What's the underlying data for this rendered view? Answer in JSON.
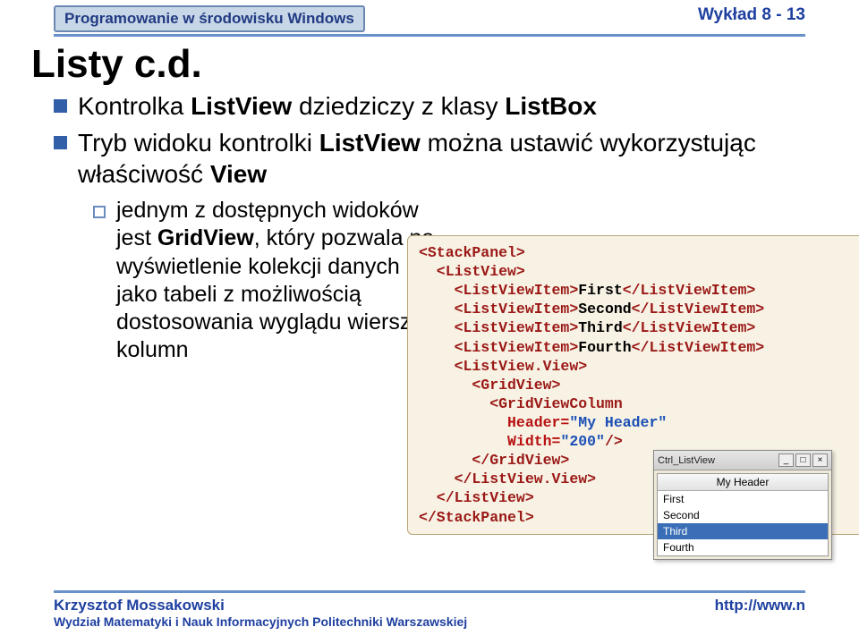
{
  "header": {
    "course": "Programowanie w środowisku Windows",
    "lecture": "Wykład 8 - 13"
  },
  "title": "Listy c.d.",
  "bullets": {
    "b1_pre": "Kontrolka ",
    "b1_lv": "ListView",
    "b1_mid": " dziedziczy z klasy ",
    "b1_lb": "ListBox",
    "b2_pre": "Tryb widoku kontrolki ",
    "b2_ctrl": "ListView",
    "b2_mid": " można ustawić wykorzystując właściwość ",
    "b2_view": "View",
    "sub_pre": "jednym z dostępnych widoków jest ",
    "sub_gv": "GridView",
    "sub_post": ", który pozwala na wyświetlenie kolekcji danych jako tabeli z możliwością dostosowania wyglądu wierszy i kolumn"
  },
  "code": {
    "sp_o": "<StackPanel>",
    "lv_o": "  <ListView>",
    "i1a": "    <ListViewItem>",
    "i1t": "First",
    "i1b": "</ListViewItem>",
    "i2a": "    <ListViewItem>",
    "i2t": "Second",
    "i2b": "</ListViewItem>",
    "i3a": "    <ListViewItem>",
    "i3t": "Third",
    "i3b": "</ListViewItem>",
    "i4a": "    <ListViewItem>",
    "i4t": "Fourth",
    "i4b": "</ListViewItem>",
    "lvv_o": "    <ListView.View>",
    "gv_o": "      <GridView>",
    "gvc": "        <GridViewColumn",
    "hdr_a": "          Header=",
    "hdr_v": "\"My Header\"",
    "w_a": "          Width=",
    "w_v": "\"200\"",
    "w_c": "/>",
    "gv_c": "      </GridView>",
    "lvv_c": "    </ListView.View>",
    "lv_c": "  </ListView>",
    "sp_c": "</StackPanel>"
  },
  "mini": {
    "title": "Ctrl_ListView",
    "btn_min": "_",
    "btn_max": "□",
    "btn_close": "×",
    "header": "My Header",
    "items": [
      "First",
      "Second",
      "Third",
      "Fourth"
    ],
    "selected_index": 2
  },
  "footer": {
    "author": "Krzysztof Mossakowski",
    "dept": "Wydział Matematyki i Nauk Informacyjnych Politechniki Warszawskiej",
    "url": "http://www.n"
  }
}
